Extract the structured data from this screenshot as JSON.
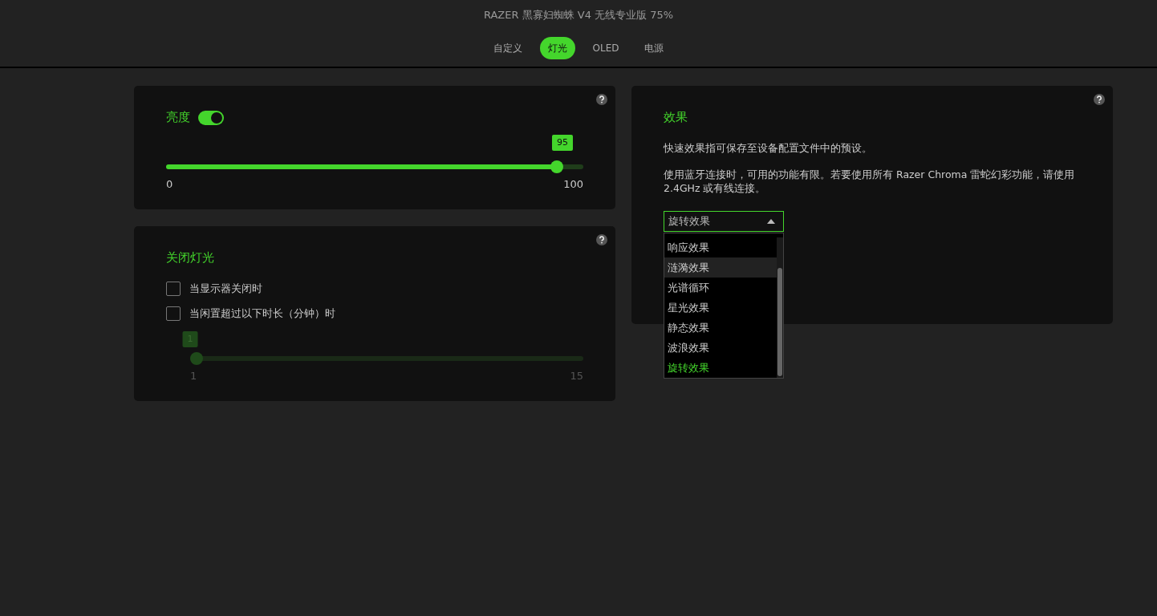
{
  "window": {
    "title": "RAZER 黑寡妇蜘蛛 V4 无线专业版 75%"
  },
  "tabs": [
    {
      "label": "自定义",
      "selected": false
    },
    {
      "label": "灯光",
      "selected": true
    },
    {
      "label": "OLED",
      "selected": false
    },
    {
      "label": "电源",
      "selected": false
    }
  ],
  "brightness": {
    "title": "亮度",
    "on": true,
    "slider": {
      "level": 0.95,
      "value": "95",
      "min": "0",
      "max": "100",
      "disabled": false
    }
  },
  "lights_off": {
    "title": "关闭灯光",
    "options": [
      {
        "label": "当显示器关闭时",
        "checked": false
      },
      {
        "label": "当闲置超过以下时长（分钟）时",
        "checked": false
      }
    ],
    "slider": {
      "level": 0,
      "value": "1",
      "min": "1",
      "max": "15",
      "disabled": true
    }
  },
  "effects": {
    "title": "效果",
    "paragraphs": [
      "快速效果指可保存至设备配置文件中的预设。",
      "使用蓝牙连接时，可用的功能有限。若要使用所有 Razer Chroma 雷蛇幻彩功能，请使用 2.4GHz 或有线连接。"
    ],
    "dropdown": {
      "value": "旋转效果",
      "expanded": true,
      "options": [
        {
          "label": "响应效果",
          "selected": false,
          "highlighted": false
        },
        {
          "label": "涟漪效果",
          "selected": false,
          "highlighted": true
        },
        {
          "label": "光谱循环",
          "selected": false,
          "highlighted": false
        },
        {
          "label": "星光效果",
          "selected": false,
          "highlighted": false
        },
        {
          "label": "静态效果",
          "selected": false,
          "highlighted": false
        },
        {
          "label": "波浪效果",
          "selected": false,
          "highlighted": false
        },
        {
          "label": "旋转效果",
          "selected": true,
          "highlighted": false
        }
      ]
    }
  }
}
